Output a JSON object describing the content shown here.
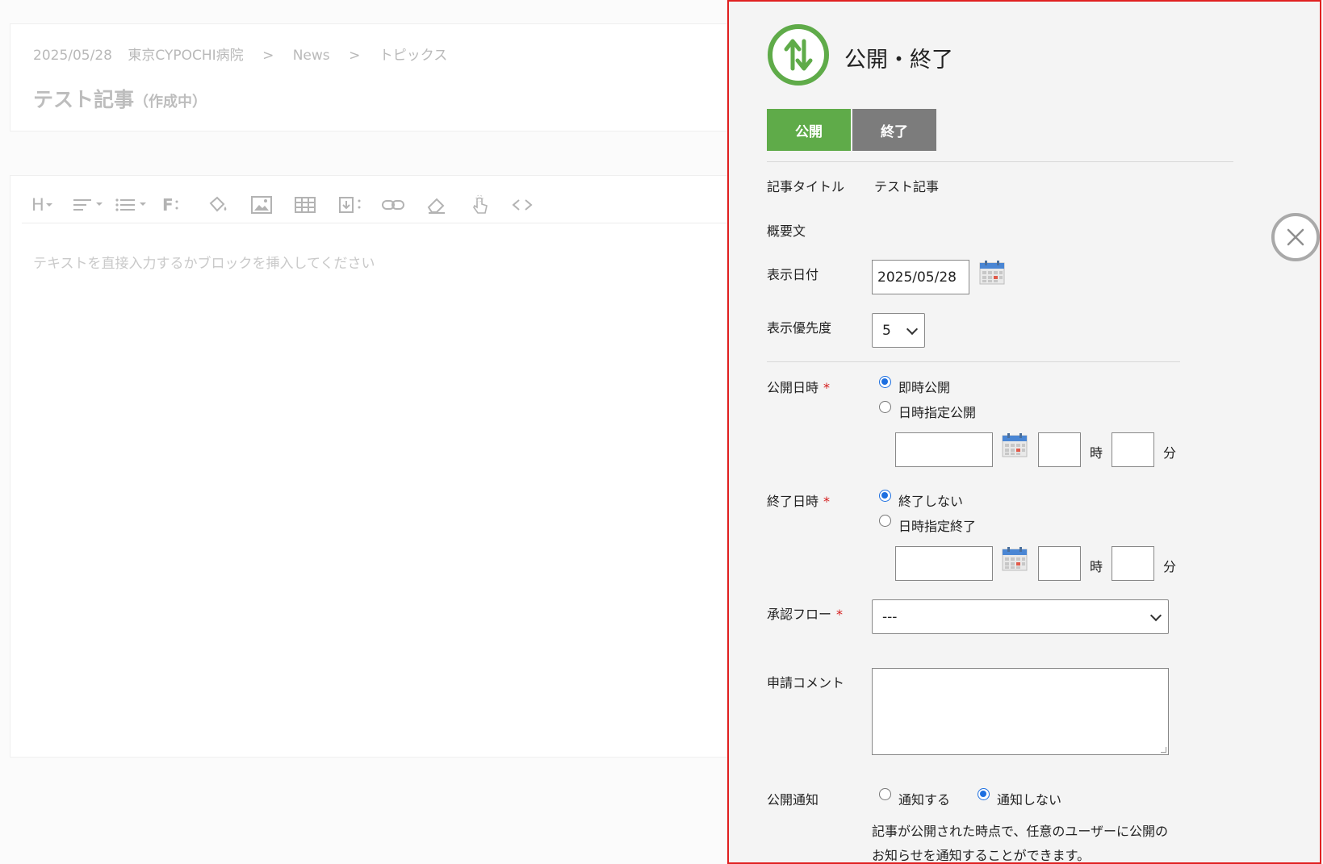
{
  "editor": {
    "breadcrumb": {
      "date": "2025/05/28",
      "site": "東京CYPOCHI病院",
      "sep1": ">",
      "section": "News",
      "sep2": ">",
      "category": "トピックス"
    },
    "title": "テスト記事",
    "title_status": "（作成中）",
    "toolbar": {
      "heading_label": "H",
      "font_label": "F"
    },
    "placeholder": "テキストを直接入力するかブロックを挿入してください"
  },
  "panel": {
    "title": "公開・終了",
    "tabs": [
      {
        "label": "公開",
        "active": true
      },
      {
        "label": "終了",
        "active": false
      }
    ],
    "article_title_label": "記事タイトル",
    "article_title_value": "テスト記事",
    "summary_label": "概要文",
    "display_date_label": "表示日付",
    "display_date_value": "2025/05/28",
    "priority_label": "表示優先度",
    "priority_value": "5",
    "publish_datetime": {
      "label": "公開日時",
      "required_mark": "*",
      "options": [
        {
          "label": "即時公開",
          "selected": true
        },
        {
          "label": "日時指定公開",
          "selected": false
        }
      ],
      "hour_unit": "時",
      "minute_unit": "分"
    },
    "end_datetime": {
      "label": "終了日時",
      "required_mark": "*",
      "options": [
        {
          "label": "終了しない",
          "selected": true
        },
        {
          "label": "日時指定終了",
          "selected": false
        }
      ],
      "hour_unit": "時",
      "minute_unit": "分"
    },
    "approval_flow": {
      "label": "承認フロー",
      "required_mark": "*",
      "value": "---"
    },
    "comment_label": "申請コメント",
    "notify": {
      "label": "公開通知",
      "options": [
        {
          "label": "通知する",
          "selected": false
        },
        {
          "label": "通知しない",
          "selected": true
        }
      ],
      "note": "記事が公開された時点で、任意のユーザーに公開のお知らせを通知することができます。"
    }
  },
  "colors": {
    "accent_green": "#5fab49",
    "tab_inactive": "#7c7c7c",
    "panel_border": "#e02020",
    "radio_selected": "#1d6fe0",
    "required": "#d41b1b"
  },
  "icons": {
    "panel_icon": "up-down-arrows-icon",
    "calendar": "calendar-icon",
    "close": "close-icon"
  }
}
